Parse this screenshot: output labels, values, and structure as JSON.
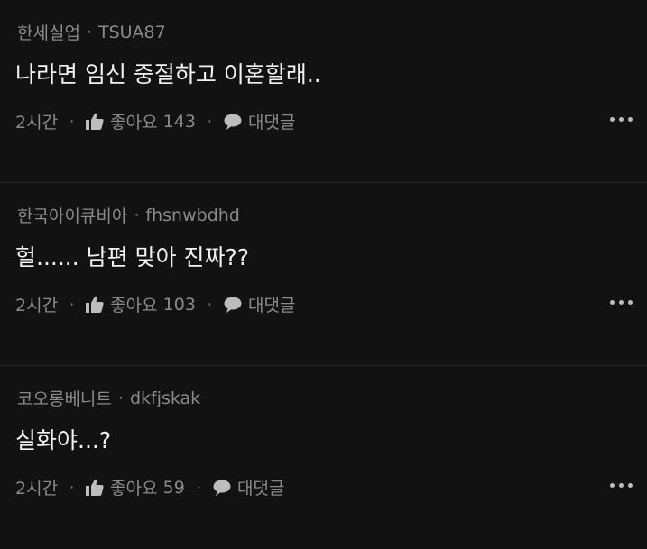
{
  "comments": [
    {
      "nickname": "한세실업",
      "username": "TSUA87",
      "text": "나라면 임신 중절하고 이혼할래..",
      "time": "2시간",
      "like_label": "좋아요",
      "like_count": "143",
      "reply_label": "대댓글"
    },
    {
      "nickname": "한국아이큐비아",
      "username": "fhsnwbdhd",
      "text": "헐...... 남편 맞아 진짜??",
      "time": "2시간",
      "like_label": "좋아요",
      "like_count": "103",
      "reply_label": "대댓글"
    },
    {
      "nickname": "코오롱베니트",
      "username": "dkfjskak",
      "text": "실화야...?",
      "time": "2시간",
      "like_label": "좋아요",
      "like_count": "59",
      "reply_label": "대댓글"
    }
  ],
  "separator": "·",
  "icons": {
    "like": "thumbs-up-icon",
    "reply": "speech-bubble-icon",
    "more": "more-options-icon"
  },
  "colors": {
    "background": "#121212",
    "meta_text": "#8a8a8a",
    "body_text": "#f2f2f2"
  }
}
